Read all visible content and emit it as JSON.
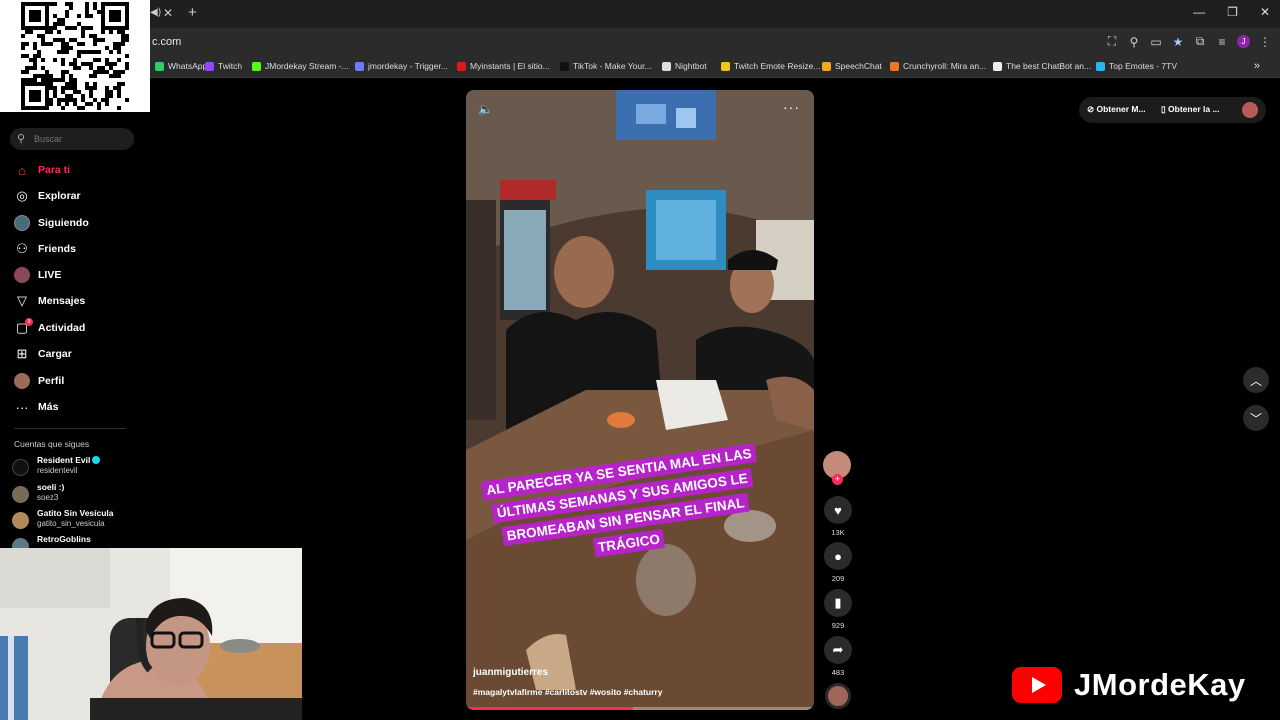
{
  "browser": {
    "url": "c.com",
    "bookmarks": [
      {
        "label": "WhatsApp",
        "color": "#25d366"
      },
      {
        "label": "Twitch",
        "color": "#9146ff"
      },
      {
        "label": "JMordekay Stream -...",
        "color": "#53fc18"
      },
      {
        "label": "jmordekay - Trigger...",
        "color": "#6b7cff"
      },
      {
        "label": "Myinstants | El sitio...",
        "color": "#d81b1b"
      },
      {
        "label": "TikTok - Make Your...",
        "color": "#111111"
      },
      {
        "label": "Nightbot",
        "color": "#dddddd"
      },
      {
        "label": "Twitch Emote Resize...",
        "color": "#f0c419"
      },
      {
        "label": "SpeechChat",
        "color": "#f5a623"
      },
      {
        "label": "Crunchyroll: Mira an...",
        "color": "#f47521"
      },
      {
        "label": "The best ChatBot an...",
        "color": "#eeeeee"
      },
      {
        "label": "Top Emotes - 7TV",
        "color": "#29b6f6"
      }
    ],
    "more_bookmarks": "»"
  },
  "sidebar": {
    "search_placeholder": "Buscar",
    "nav": [
      {
        "label": "Para ti",
        "icon": "home-icon",
        "glyph": "⌂"
      },
      {
        "label": "Explorar",
        "icon": "compass-icon",
        "glyph": "◎"
      },
      {
        "label": "Siguiendo",
        "icon": "following-avatar-icon",
        "glyph": ""
      },
      {
        "label": "Friends",
        "icon": "friends-icon",
        "glyph": "⚇"
      },
      {
        "label": "LIVE",
        "icon": "live-avatar-icon",
        "glyph": ""
      },
      {
        "label": "Mensajes",
        "icon": "send-icon",
        "glyph": "▽"
      },
      {
        "label": "Actividad",
        "icon": "activity-icon",
        "glyph": "▢"
      },
      {
        "label": "Cargar",
        "icon": "upload-icon",
        "glyph": "⊞"
      },
      {
        "label": "Perfil",
        "icon": "profile-avatar-icon",
        "glyph": ""
      },
      {
        "label": "Más",
        "icon": "more-icon",
        "glyph": "···"
      }
    ],
    "following_title": "Cuentas que sigues",
    "accounts": [
      {
        "name": "Resident Evil",
        "handle": "residentevil",
        "verified": true
      },
      {
        "name": "soelí :)",
        "handle": "soez3",
        "verified": false
      },
      {
        "name": "Gatito Sin Vesícula",
        "handle": "gatito_sin_vesicula",
        "verified": false
      },
      {
        "name": "RetroGoblins",
        "handle": "",
        "verified": false
      }
    ]
  },
  "video": {
    "caption": "AL PARECER YA SE SENTIA MAL EN LAS ÚLTIMAS SEMANAS Y SUS AMIGOS LE BROMEABAN SIN PENSAR EL FINAL TRÁGICO",
    "username": "juanmigutierres",
    "hashtags": "#magalytvlafirme #carlitostv #wosito #chaturry",
    "progress": 0.48
  },
  "actions": {
    "likes": "13K",
    "comments": "209",
    "saves": "929",
    "shares": "483"
  },
  "top_right": {
    "get_app_1": "Obtener M...",
    "get_app_2": "Obtener la ..."
  },
  "brand": {
    "name": "JMordeKay"
  }
}
